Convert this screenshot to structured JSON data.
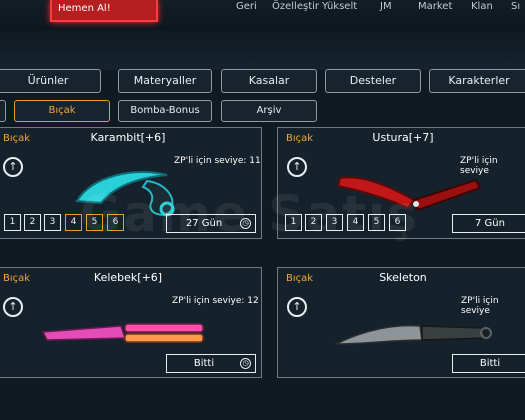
{
  "promo": {
    "label": "Hemen Al!"
  },
  "nav": [
    "Geri",
    "Özelleştir",
    "Yükselt",
    "JM",
    "Market",
    "Klan",
    "Sı"
  ],
  "tabs": [
    "Ürünler",
    "Materyaller",
    "Kasalar",
    "Desteler",
    "Karakterler"
  ],
  "subtabs": [
    "Bıçak",
    "Bomba-Bonus",
    "Arşiv"
  ],
  "watermark": "Game Satış",
  "cards": [
    {
      "category": "Bıçak",
      "title": "Karambit[+6]",
      "level": "ZP'li için seviye: 11",
      "upgrades": [
        "1",
        "2",
        "3",
        "4",
        "5",
        "6"
      ],
      "timer": "27 Gün",
      "clock_icon": "clock-icon"
    },
    {
      "category": "Bıçak",
      "title": "Ustura[+7]",
      "level": "ZP'li için seviye",
      "upgrades": [
        "1",
        "2",
        "3",
        "4",
        "5",
        "6"
      ],
      "timer": "7 Gün",
      "clock_icon": "clock-icon"
    },
    {
      "category": "Bıçak",
      "title": "Kelebek[+6]",
      "level": "ZP'li için seviye: 12",
      "timer": "Bitti",
      "clock_icon": "clock-icon"
    },
    {
      "category": "Bıçak",
      "title": "Skeleton",
      "level": "ZP'li için seviye",
      "timer": "Bitti"
    }
  ],
  "colors": {
    "accent": "#f0a640",
    "promo": "#b51f1f",
    "panel": "#16222b"
  }
}
